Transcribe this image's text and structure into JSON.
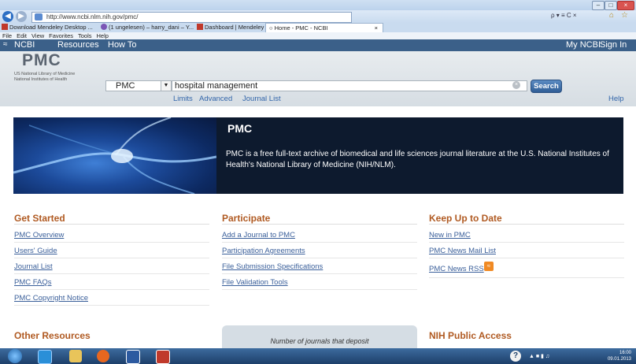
{
  "browser": {
    "url": "http://www.ncbi.nlm.nih.gov/pmc/",
    "search_icons": "ρ ▾ ≡ C ×",
    "tabs": [
      {
        "label": "Download Mendeley Desktop ...",
        "icon": "mendeley-icon"
      },
      {
        "label": "(1 ungelesen) – harry_dani – Y...",
        "icon": "yahoo-icon"
      },
      {
        "label": "Dashboard | Mendeley",
        "icon": "mendeley-icon"
      },
      {
        "label": "Home - PMC - NCBI",
        "icon": "globe-icon",
        "active": true
      }
    ],
    "menu": [
      "File",
      "Edit",
      "View",
      "Favorites",
      "Tools",
      "Help"
    ]
  },
  "ncbi_bar": {
    "logo": "NCBI",
    "resources": "Resources",
    "howto": "How To",
    "my_ncbi": "My NCBI",
    "sign_in": "Sign In"
  },
  "search": {
    "logo": "PMC",
    "logo_sub1": "US National Library of Medicine",
    "logo_sub2": "National Institutes of Health",
    "database": "PMC",
    "query": "hospital management",
    "button": "Search",
    "limits": "Limits",
    "advanced": "Advanced",
    "journal_list": "Journal List",
    "help": "Help"
  },
  "banner": {
    "title": "PMC",
    "text": "PMC is a free full-text archive of biomedical and life sciences journal literature at the U.S. National Institutes of Health's National Library of Medicine (NIH/NLM)."
  },
  "columns": {
    "get_started": {
      "title": "Get Started",
      "links": [
        "PMC Overview",
        "Users' Guide",
        "Journal List",
        "PMC FAQs",
        "PMC Copyright Notice"
      ]
    },
    "participate": {
      "title": "Participate",
      "links": [
        "Add a Journal to PMC",
        "Participation Agreements",
        "File Submission Specifications",
        "File Validation Tools"
      ]
    },
    "keep_up": {
      "title": "Keep Up to Date",
      "links": [
        "New in PMC",
        "PMC News Mail List",
        "PMC News RSS"
      ]
    }
  },
  "lower": {
    "other_resources": "Other Resources",
    "number_box": "Number of journals that deposit",
    "nih_public_access": "NIH Public Access"
  },
  "taskbar": {
    "time": "16:00",
    "date": "09.01.2013"
  },
  "colors": {
    "ncbi_bar": "#3b6089",
    "heading_orange": "#b05a22",
    "link_blue": "#3a5f9a"
  }
}
